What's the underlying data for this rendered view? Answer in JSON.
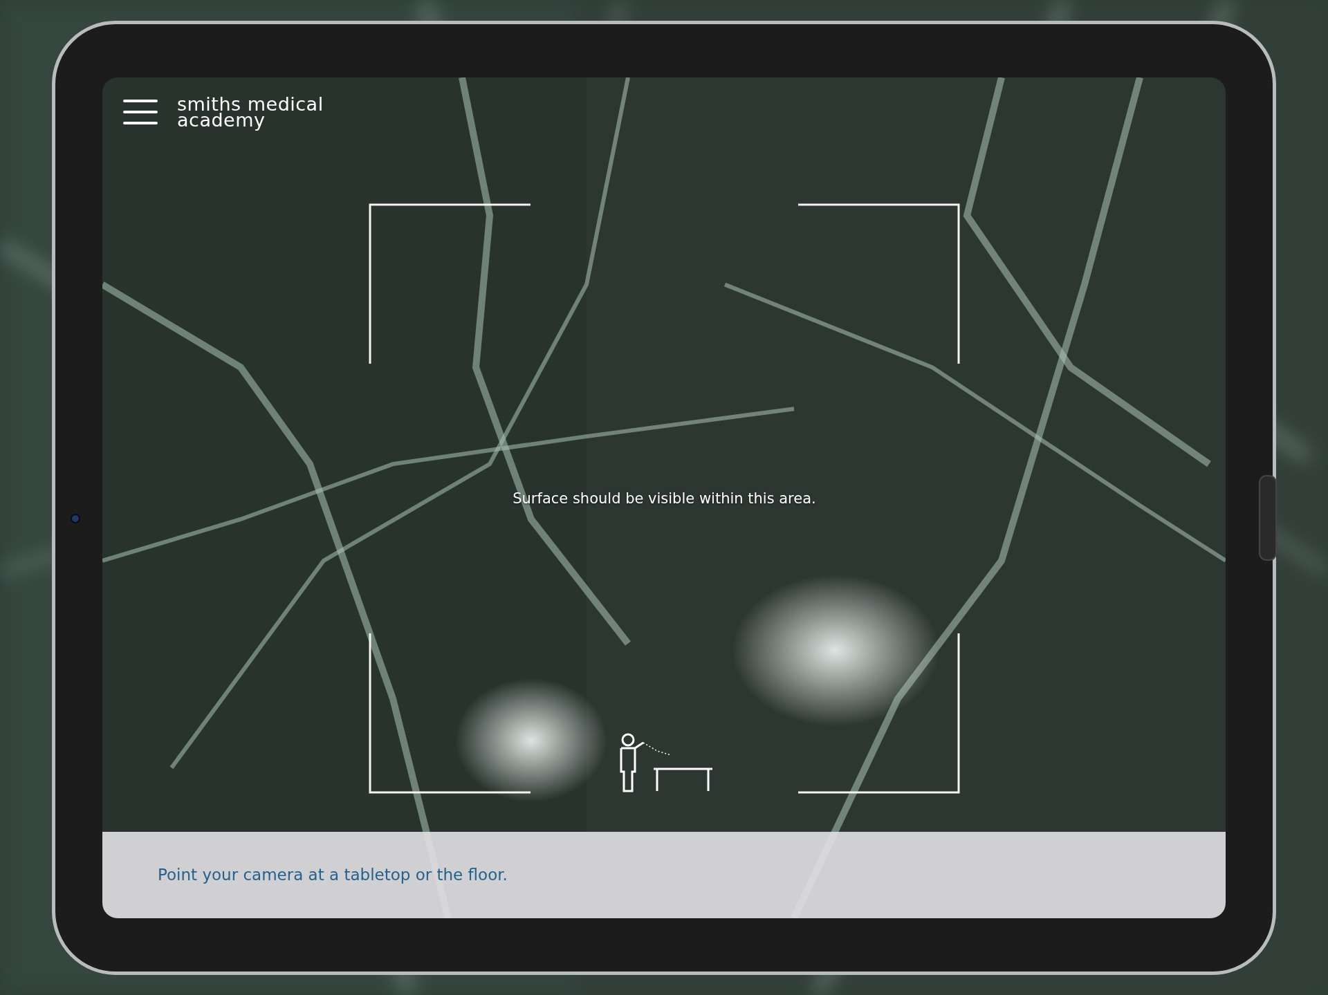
{
  "app_header": {
    "logo_lines": [
      "smiths medical",
      "academy"
    ]
  },
  "scan_area": {
    "hint": "Surface should be visible within this area."
  },
  "instruction_bar": {
    "text": "Point your camera at a tabletop or the floor."
  }
}
